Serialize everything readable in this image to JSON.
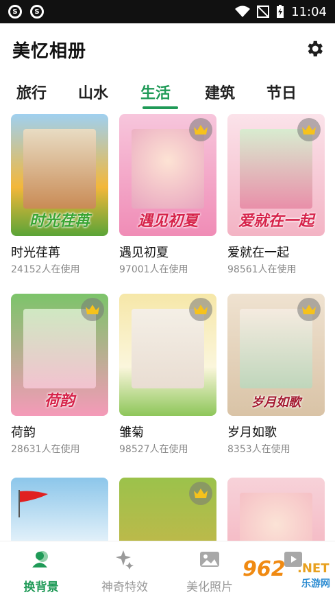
{
  "status_bar": {
    "time": "11:04"
  },
  "app": {
    "title": "美忆相册"
  },
  "tabs": [
    {
      "label": "旅行",
      "active": false
    },
    {
      "label": "山水",
      "active": false
    },
    {
      "label": "生活",
      "active": true
    },
    {
      "label": "建筑",
      "active": false
    },
    {
      "label": "节日",
      "active": false
    }
  ],
  "templates": [
    {
      "title": "时光荏苒",
      "usage": "24152人在使用",
      "caption": "时光荏苒",
      "premium": false,
      "bg": "#f3b73a"
    },
    {
      "title": "遇见初夏",
      "usage": "97001人在使用",
      "caption": "遇见初夏",
      "premium": true,
      "bg": "#f5a9c7"
    },
    {
      "title": "爱就在一起",
      "usage": "98561人在使用",
      "caption": "爱就在一起",
      "premium": true,
      "bg": "#f6d5dd"
    },
    {
      "title": "荷韵",
      "usage": "28631人在使用",
      "caption": "荷韵",
      "premium": true,
      "bg": "#6cbf5a"
    },
    {
      "title": "雏菊",
      "usage": "98527人在使用",
      "caption": "",
      "premium": true,
      "bg": "#f4e6a6"
    },
    {
      "title": "岁月如歌",
      "usage": "8353人在使用",
      "caption": "岁月如歌",
      "premium": true,
      "bg": "#ead9c4"
    },
    {
      "title": "",
      "usage": "",
      "caption": "",
      "premium": false,
      "bg": "#8cc6ea"
    },
    {
      "title": "",
      "usage": "",
      "caption": "",
      "premium": true,
      "bg": "#9bc24b"
    },
    {
      "title": "",
      "usage": "",
      "caption": "",
      "premium": false,
      "bg": "#f7b9c4"
    }
  ],
  "bottom_nav": [
    {
      "label": "换背景",
      "icon": "person-background-icon",
      "active": true
    },
    {
      "label": "神奇特效",
      "icon": "sparkle-icon",
      "active": false
    },
    {
      "label": "美化照片",
      "icon": "image-icon",
      "active": false
    },
    {
      "label": "",
      "icon": "video-icon",
      "active": false
    }
  ],
  "watermark": {
    "number": "962",
    "net": ".NET",
    "sub": "乐游网"
  },
  "colors": {
    "accent": "#1f9a57",
    "text": "#111111",
    "muted": "#888888"
  }
}
